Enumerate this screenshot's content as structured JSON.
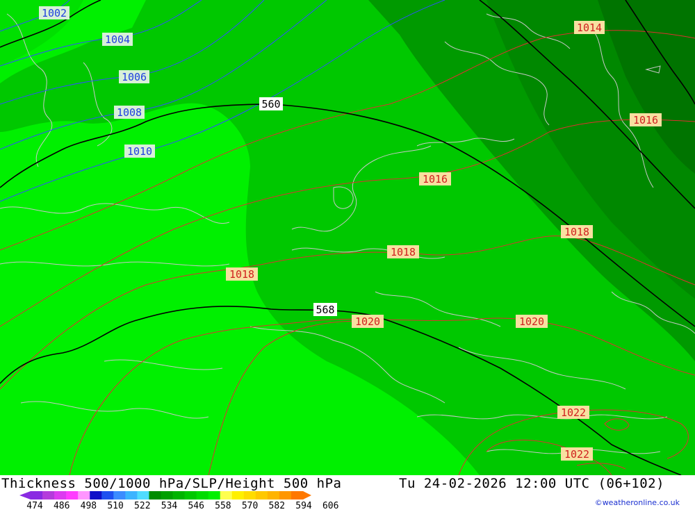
{
  "title_left": "Thickness 500/1000 hPa/SLP/Height 500 hPa",
  "title_right": "Tu 24-02-2026 12:00 UTC (06+102)",
  "credit": "©weatheronline.co.uk",
  "colorbar": {
    "ticks": [
      "474",
      "486",
      "498",
      "510",
      "522",
      "534",
      "546",
      "558",
      "570",
      "582",
      "594",
      "606"
    ],
    "colors": [
      "#8a2be2",
      "#b43cdc",
      "#dc3cf0",
      "#ff3cff",
      "#ff96ff",
      "#1010c8",
      "#1e50f0",
      "#3c8cff",
      "#3cb4ff",
      "#50dcff",
      "#008c00",
      "#00a000",
      "#00b400",
      "#00c800",
      "#00dc00",
      "#00f000",
      "#ffff50",
      "#fff000",
      "#ffdc00",
      "#ffc800",
      "#ffb400",
      "#ff9600",
      "#ff7800"
    ]
  },
  "isobars_blue": [
    "1002",
    "1004",
    "1006",
    "1008",
    "1010"
  ],
  "isobars_red": [
    "1014",
    "1016",
    "1016",
    "1018",
    "1018",
    "1018",
    "1020",
    "1020",
    "1022",
    "1022"
  ],
  "height_contours": [
    "560",
    "568"
  ],
  "colors": {
    "thickness_light": "#00f000",
    "thickness_mid": "#00c800",
    "thickness_dark": "#009a00",
    "thickness_darkest": "#007800",
    "isobar_low": "#3050ff",
    "isobar_high": "#e03030",
    "coast": "#c8c8c8"
  }
}
